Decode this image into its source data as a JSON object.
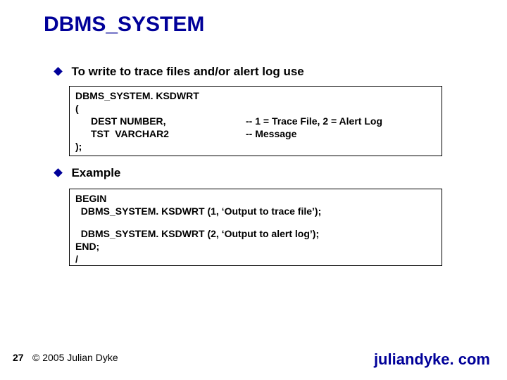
{
  "title": "DBMS_SYSTEM",
  "bullets": {
    "b1": "To write to trace files and/or alert log use",
    "b2": "Example"
  },
  "codebox1": {
    "l1": "DBMS_SYSTEM. KSDWRT",
    "l2": "(",
    "l3_left": "DEST NUMBER,",
    "l3_right": "-- 1 = Trace File, 2 = Alert Log",
    "l4_left": "TST  VARCHAR2",
    "l4_right": "-- Message",
    "l5": ");"
  },
  "codebox2": {
    "l1": "BEGIN",
    "l2": "  DBMS_SYSTEM. KSDWRT (1, ‘Output to trace file’);",
    "l3": "  DBMS_SYSTEM. KSDWRT (2, ‘Output to alert log’);",
    "l4": "END;",
    "l5": "/"
  },
  "footer": {
    "page": "27",
    "copyright": "© 2005 Julian Dyke",
    "site": "juliandyke. com"
  }
}
